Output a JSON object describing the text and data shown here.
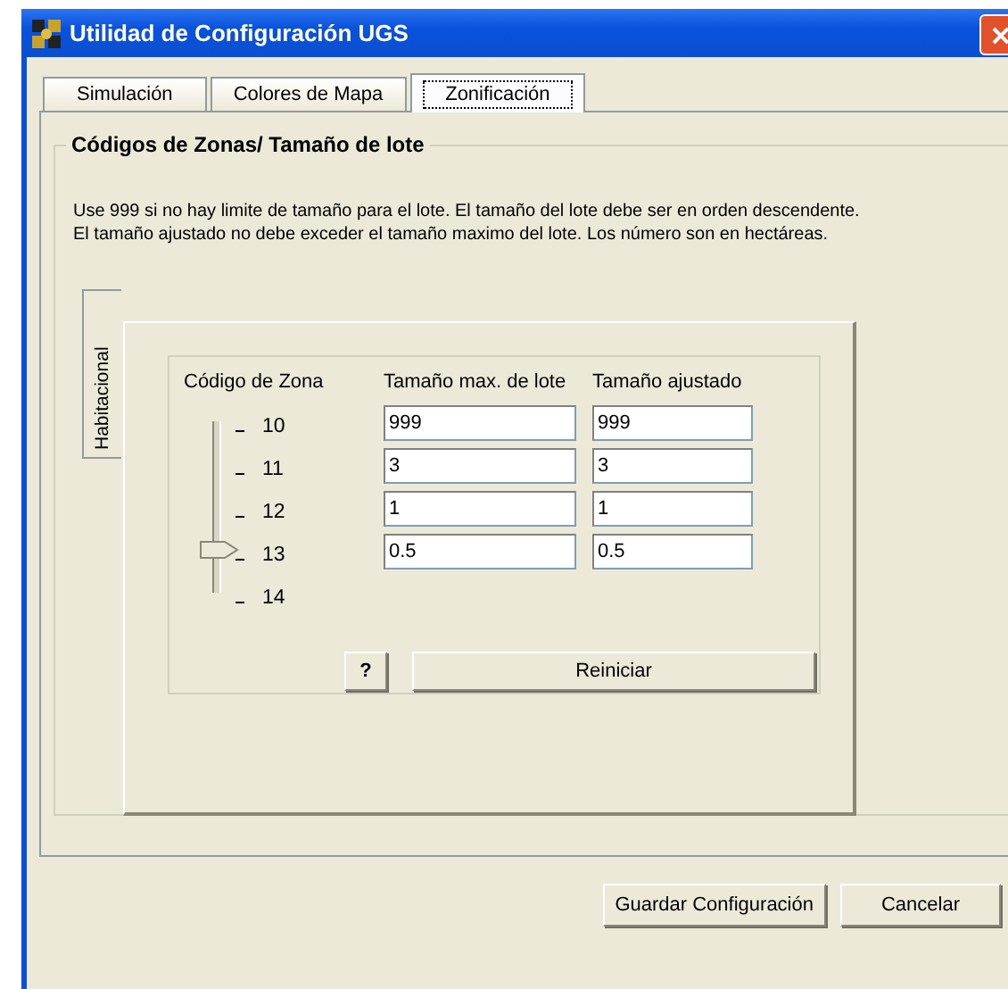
{
  "window": {
    "title": "Utilidad de Configuración UGS"
  },
  "tabs": [
    {
      "label": "Simulación",
      "selected": false
    },
    {
      "label": "Colores de Mapa",
      "selected": false
    },
    {
      "label": "Zonificación",
      "selected": true
    }
  ],
  "group": {
    "title": "Códigos de Zonas/ Tamaño de lote",
    "description": [
      "Use 999 si no hay limite de tamaño para el lote. El tamaño del lote debe ser en orden descendente.",
      "El tamaño ajustado no debe exceder el tamaño maximo del lote. Los número son en hectáreas."
    ]
  },
  "side_tabs": [
    {
      "label": "Habitacional",
      "selected": true
    }
  ],
  "columns": [
    "Código de Zona",
    "Tamaño max. de lote",
    "Tamaño ajustado"
  ],
  "rows": [
    {
      "code": "10",
      "max": "999",
      "adjusted": "999",
      "selected": false
    },
    {
      "code": "11",
      "max": "3",
      "adjusted": "3",
      "selected": false
    },
    {
      "code": "12",
      "max": "1",
      "adjusted": "1",
      "selected": false
    },
    {
      "code": "13",
      "max": "0.5",
      "adjusted": "0.5",
      "selected": true
    },
    {
      "code": "14",
      "selected": false
    }
  ],
  "help_button": "?",
  "reset_button": "Reiniciar",
  "buttons": [
    "Guardar Configuración",
    "Cancelar"
  ]
}
